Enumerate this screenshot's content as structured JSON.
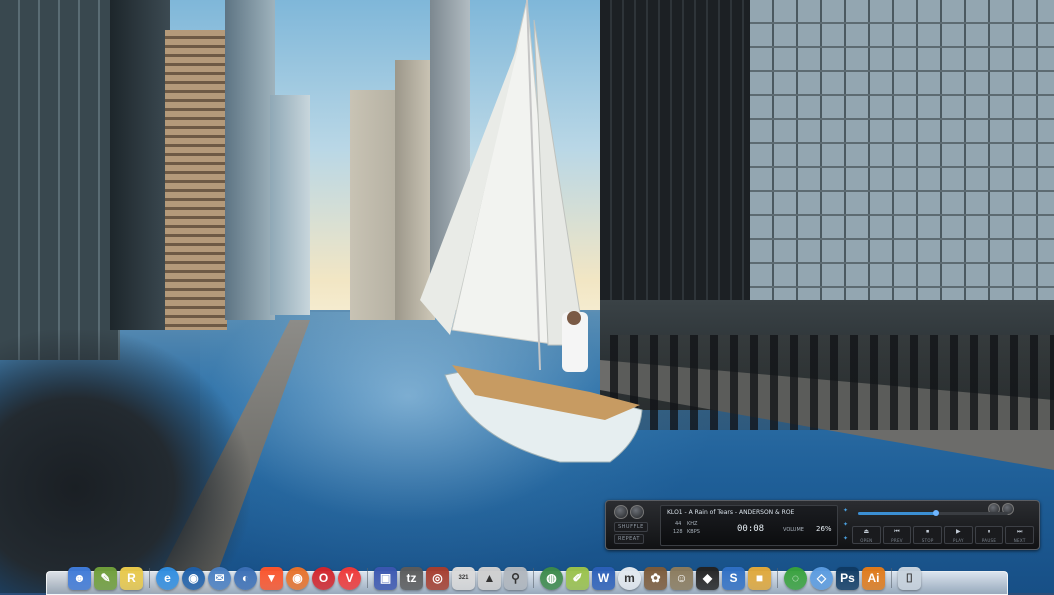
{
  "player": {
    "title": "KLO1 - A Rain of Tears - ANDERSON & ROE",
    "kbps_label": "KBPS",
    "kbps_value": "128",
    "khz_label": "KHZ",
    "khz_value": "44",
    "time": "00:08",
    "volume_label": "VOLUME",
    "volume_value": "26%",
    "shuffle_label": "SHUFFLE",
    "repeat_label": "REPEAT",
    "progress": 0.52,
    "controls": [
      {
        "glyph": "⏏",
        "label": "OPEN"
      },
      {
        "glyph": "⏮",
        "label": "PREV"
      },
      {
        "glyph": "⏹",
        "label": "STOP"
      },
      {
        "glyph": "▶",
        "label": "PLAY"
      },
      {
        "glyph": "⏸",
        "label": "PAUSE"
      },
      {
        "glyph": "⏭",
        "label": "NEXT"
      }
    ]
  },
  "dock": {
    "icons": [
      {
        "name": "finder-icon",
        "glyph": "☻",
        "bg": "#3f7ad8"
      },
      {
        "name": "notepad-icon",
        "glyph": "✎",
        "bg": "#6f9e3a"
      },
      {
        "name": "r-app-icon",
        "glyph": "R",
        "bg": "#e9c94a"
      },
      {
        "sep": true
      },
      {
        "name": "internet-explorer-icon",
        "glyph": "e",
        "bg": "#2f8de0",
        "round": true
      },
      {
        "name": "firefox-old-icon",
        "glyph": "◉",
        "bg": "#1e5fa8",
        "round": true
      },
      {
        "name": "thunderbird-icon",
        "glyph": "✉",
        "bg": "#4a7fc2",
        "round": true
      },
      {
        "name": "cloud-globe-icon",
        "glyph": "◐",
        "bg": "#3b6fb6",
        "round": true
      },
      {
        "name": "brave-icon",
        "glyph": "▼",
        "bg": "#fb542b"
      },
      {
        "name": "firefox-icon",
        "glyph": "◉",
        "bg": "#e8722a",
        "round": true
      },
      {
        "name": "opera-icon",
        "glyph": "O",
        "bg": "#d3242b",
        "round": true
      },
      {
        "name": "vivaldi-icon",
        "glyph": "V",
        "bg": "#ef3939",
        "round": true
      },
      {
        "sep": true
      },
      {
        "name": "save-icon",
        "glyph": "▣",
        "bg": "#3a56b0"
      },
      {
        "name": "archive-tz-icon",
        "glyph": "tz",
        "bg": "#5a5a5a"
      },
      {
        "name": "camera-icon",
        "glyph": "◎",
        "bg": "#a63d2e"
      },
      {
        "name": "media-player-321-icon",
        "glyph": "321",
        "bg": "#d9d9d9",
        "dark": true
      },
      {
        "name": "ascend-icon",
        "glyph": "▲",
        "bg": "#cfcfcf",
        "dark": true
      },
      {
        "name": "search-magnifier-icon",
        "glyph": "⚲",
        "bg": "#b0b6bd",
        "dark": true
      },
      {
        "sep": true
      },
      {
        "name": "globe-icon",
        "glyph": "◍",
        "bg": "#3c8a4a",
        "round": true
      },
      {
        "name": "pencil-icon",
        "glyph": "✐",
        "bg": "#9ac24a"
      },
      {
        "name": "word-icon",
        "glyph": "W",
        "bg": "#2b5fb8"
      },
      {
        "name": "mindmap-icon",
        "glyph": "m",
        "bg": "#e3e9ef",
        "dark": true,
        "round": true
      },
      {
        "name": "paint-palette-icon",
        "glyph": "✿",
        "bg": "#7b5a3a"
      },
      {
        "name": "gimp-icon",
        "glyph": "☺",
        "bg": "#8a7a5c"
      },
      {
        "name": "inkscape-icon",
        "glyph": "◆",
        "bg": "#222222"
      },
      {
        "name": "shield-icon",
        "glyph": "S",
        "bg": "#2f6fc4"
      },
      {
        "name": "color-blocks-icon",
        "glyph": "■",
        "bg": "#e0a83a"
      },
      {
        "sep": true
      },
      {
        "name": "green-swirl-icon",
        "glyph": "◌",
        "bg": "#37a13c",
        "round": true
      },
      {
        "name": "network-icon",
        "glyph": "◇",
        "bg": "#5a9be0",
        "round": true
      },
      {
        "name": "photoshop-icon",
        "glyph": "Ps",
        "bg": "#0f3a63"
      },
      {
        "name": "illustrator-icon",
        "glyph": "Ai",
        "bg": "#e07a1a"
      },
      {
        "sep": true
      },
      {
        "name": "trash-icon",
        "glyph": "⌷",
        "bg": "#c8d3dd",
        "dark": true
      }
    ]
  }
}
